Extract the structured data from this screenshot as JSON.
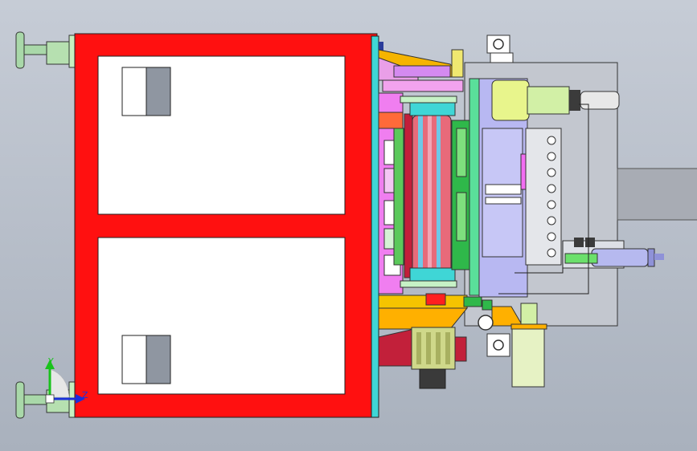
{
  "axes": {
    "y_label": "Y",
    "z_label": "Z",
    "y_color": "#19c21c",
    "z_color": "#1a2fd9"
  },
  "colors": {
    "frame_red": "#ff1010",
    "background_top": "#c6ccd6",
    "background_bottom": "#a9b1bd"
  }
}
